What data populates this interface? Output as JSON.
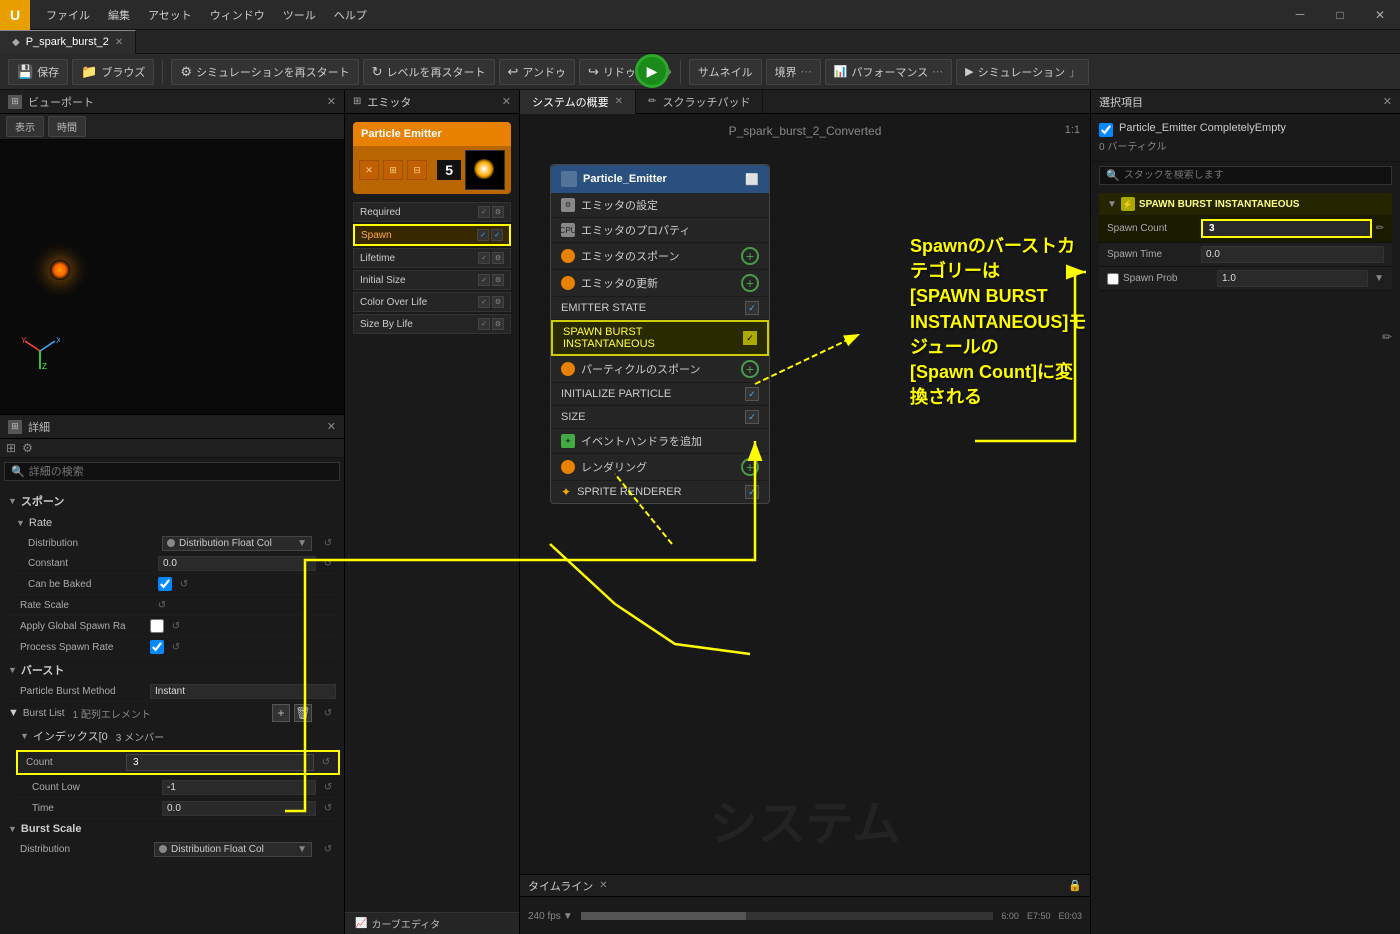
{
  "titleBar": {
    "menus": [
      "ファイル",
      "編集",
      "アセット",
      "ウィンドウ",
      "ツール",
      "ヘルプ"
    ],
    "menusDuplicate": [
      "ツール",
      "ヘルプ"
    ],
    "windowControls": [
      "－",
      "□",
      "✕"
    ]
  },
  "tabBar": {
    "tabs": [
      {
        "label": "P_spark_burst_2",
        "active": true
      }
    ]
  },
  "toolbar": {
    "save": "保存",
    "browse": "ブラウズ",
    "restartSim": "シミュレーションを再スタート",
    "restartLevel": "レベルを再スタート",
    "undo": "アンドゥ",
    "redo": "リドゥ",
    "thumbnail": "サムネイル",
    "boundary": "境界",
    "performance": "パフォーマンス",
    "simulation": "シミュレーション"
  },
  "viewportPanel": {
    "title": "ビューポート",
    "display": "表示",
    "time": "時間"
  },
  "detailsPanel": {
    "title": "詳細",
    "searchPlaceholder": "詳細の検索",
    "sections": {
      "spawn": "スポーン",
      "rate": "Rate",
      "distribution": "Distribution",
      "constant": "Constant",
      "constantValue": "0.0",
      "canBeBaked": "Can be Baked",
      "rateScale": "Rate Scale",
      "applyGlobalSpawnRate": "Apply Global Spawn Ra",
      "processSpawnRate": "Process Spawn Rate",
      "burst": "バースト",
      "particleBurstMethod": "Particle Burst Method",
      "particleBurstMethodValue": "Instant",
      "burstList": "Burst List",
      "burstListValue": "1 配列エレメント",
      "index0": "インデックス[0",
      "index0Members": "3 メンバー",
      "count": "Count",
      "countValue": "3",
      "countLow": "Count Low",
      "countLowValue": "-1",
      "time": "Time",
      "timeValue": "0.0",
      "burstScale": "Burst Scale",
      "distributionBottom": "Distribution",
      "distributionFloatLabel": "Distribution Float Col",
      "distributionFloatLabel2": "Distribution Float Col"
    }
  },
  "emitterPanel": {
    "title": "エミッタ",
    "emitterName": "Particle Emitter",
    "number": "5",
    "modules": [
      {
        "name": "Required",
        "checked": true,
        "isSpawn": false
      },
      {
        "name": "Spawn",
        "checked": true,
        "isSpawn": true,
        "highlighted": true
      },
      {
        "name": "Lifetime",
        "checked": true,
        "isSpawn": false
      },
      {
        "name": "Initial Size",
        "checked": true,
        "isSpawn": false
      },
      {
        "name": "Color Over Life",
        "checked": true,
        "isSpawn": false
      },
      {
        "name": "Size By Life",
        "checked": true,
        "isSpawn": false
      }
    ]
  },
  "centerPanel": {
    "tabs": [
      {
        "label": "システムの概要",
        "active": true
      },
      {
        "label": "スクラッチパッド"
      }
    ],
    "systemName": "P_spark_burst_2_Converted",
    "ratio": "1:1",
    "particleEmitterNode": {
      "title": "Particle_Emitter",
      "items": [
        {
          "name": "エミッタの設定",
          "type": "settings",
          "hasAdd": false
        },
        {
          "name": "エミッタのプロパティ",
          "type": "cpu",
          "hasAdd": false
        },
        {
          "name": "エミッタのスポーン",
          "type": "orange",
          "hasAdd": true
        },
        {
          "name": "エミッタの更新",
          "type": "orange",
          "hasAdd": true
        },
        {
          "name": "EMITTER STATE",
          "type": "plain",
          "hasCheck": true
        },
        {
          "name": "SPAWN BURST INSTANTANEOUS",
          "type": "burst",
          "hasCheck": true,
          "highlighted": true
        },
        {
          "name": "パーティクルのスポーン",
          "type": "orange",
          "hasAdd": true
        },
        {
          "name": "INITIALIZE PARTICLE",
          "type": "plain",
          "hasCheck": true
        },
        {
          "name": "SIZE",
          "type": "plain",
          "hasCheck": true
        },
        {
          "name": "イベントハンドラを追加",
          "type": "add"
        },
        {
          "name": "レンダリング",
          "type": "orange",
          "hasAdd": true
        },
        {
          "name": "SPRITE RENDERER",
          "type": "star",
          "hasCheck": true
        }
      ]
    },
    "timeline": {
      "label": "タイムライン",
      "fps": "240 fps",
      "time1": "6:00",
      "time2": "E7:50",
      "time3": "E0:03"
    }
  },
  "selectionPanel": {
    "title": "選択項目",
    "selectionName": "Particle_Emitter CompletelyEmpty",
    "particleCount": "0 バーティクル",
    "searchPlaceholder": "スタックを検索します",
    "spawnBurstSection": {
      "title": "SPAWN BURST INSTANTANEOUS",
      "spawnCount": "Spawn Count",
      "spawnCountValue": "3",
      "spawnTime": "Spawn Time",
      "spawnTimeValue": "0.0",
      "spawnProb": "Spawn Prob",
      "spawnProbValue": "1.0"
    }
  },
  "annotation": {
    "line1": "Spawnのバーストカテゴリーは",
    "line2": "[SPAWN BURST INSTANTANEOUS]モジュールの",
    "line3": "[Spawn Count]に変換される"
  },
  "curveEditor": "カーブエディタ"
}
